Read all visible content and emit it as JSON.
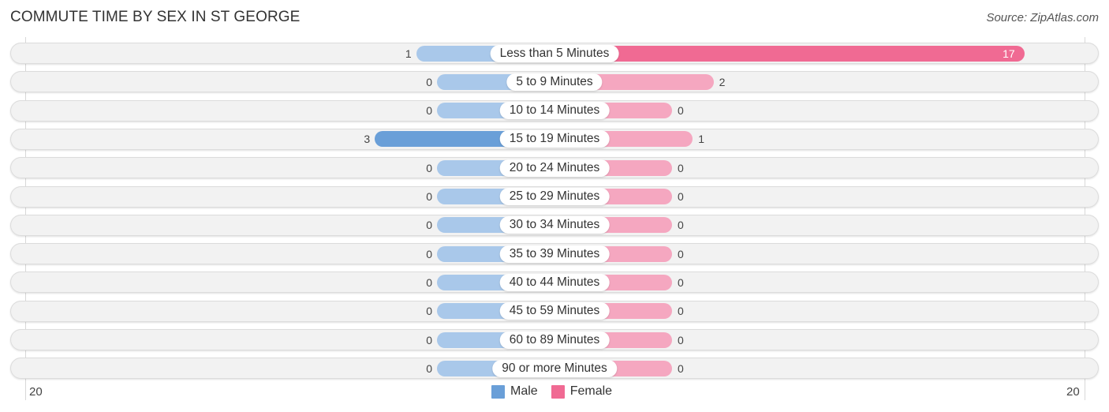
{
  "title": "COMMUTE TIME BY SEX IN ST GEORGE",
  "source": "Source: ZipAtlas.com",
  "colors": {
    "male": "#a9c8ea",
    "male_strong": "#6a9fd8",
    "female": "#f5a7c0",
    "female_strong": "#f06a93"
  },
  "chart_data": {
    "type": "bar",
    "orientation": "horizontal-diverging",
    "title": "COMMUTE TIME BY SEX IN ST GEORGE",
    "categories": [
      "Less than 5 Minutes",
      "5 to 9 Minutes",
      "10 to 14 Minutes",
      "15 to 19 Minutes",
      "20 to 24 Minutes",
      "25 to 29 Minutes",
      "30 to 34 Minutes",
      "35 to 39 Minutes",
      "40 to 44 Minutes",
      "45 to 59 Minutes",
      "60 to 89 Minutes",
      "90 or more Minutes"
    ],
    "series": [
      {
        "name": "Male",
        "values": [
          1,
          0,
          0,
          3,
          0,
          0,
          0,
          0,
          0,
          0,
          0,
          0
        ]
      },
      {
        "name": "Female",
        "values": [
          17,
          2,
          0,
          1,
          0,
          0,
          0,
          0,
          0,
          0,
          0,
          0
        ]
      }
    ],
    "axis_min_label": "20",
    "axis_max_label": "20",
    "xlim": [
      -20,
      20
    ],
    "legend": [
      "Male",
      "Female"
    ],
    "legend_position": "bottom-center",
    "grid": false
  }
}
